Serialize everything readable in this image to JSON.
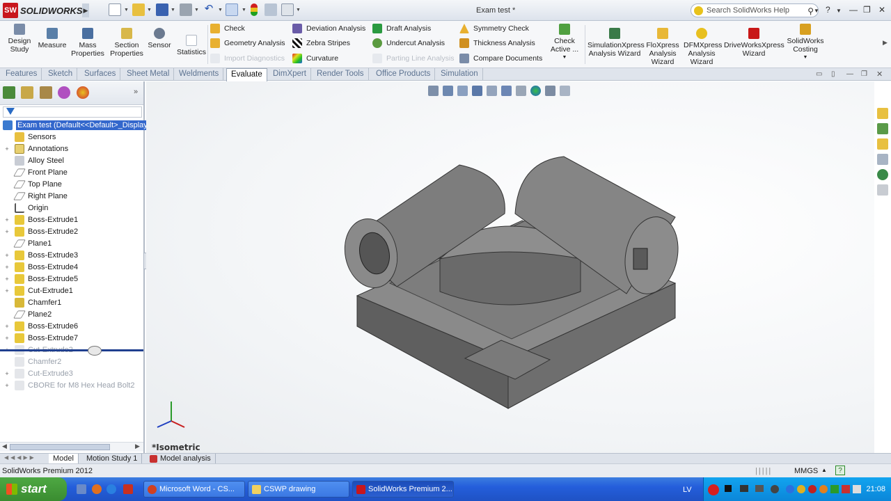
{
  "app": {
    "name": "SOLIDWORKS",
    "document_title": "Exam test *",
    "search_placeholder": "Search SolidWorks Help"
  },
  "toolbar": {
    "big_tools": [
      {
        "label": "Design\nStudy",
        "icon": "design-study-icon"
      },
      {
        "label": "Measure",
        "icon": "measure-icon"
      },
      {
        "label": "Mass\nProperties",
        "icon": "mass-properties-icon"
      },
      {
        "label": "Section\nProperties",
        "icon": "section-properties-icon"
      },
      {
        "label": "Sensor",
        "icon": "sensor-icon"
      },
      {
        "label": "Statistics",
        "icon": "statistics-icon"
      }
    ],
    "col1": [
      "Check",
      "Geometry Analysis",
      "Import Diagnostics"
    ],
    "col2": [
      "Deviation Analysis",
      "Zebra Stripes",
      "Curvature"
    ],
    "col3": [
      "Draft Analysis",
      "Undercut Analysis",
      "Parting Line Analysis"
    ],
    "col4": [
      "Symmetry Check",
      "Thickness Analysis",
      "Compare Documents"
    ],
    "check_active": "Check\nActive ...",
    "wizards": [
      "SimulationXpress\nAnalysis Wizard",
      "FloXpress\nAnalysis\nWizard",
      "DFMXpress\nAnalysis\nWizard",
      "DriveWorksXpress\nWizard",
      "SolidWorks\nCosting"
    ]
  },
  "tabs": [
    "Features",
    "Sketch",
    "Surfaces",
    "Sheet Metal",
    "Weldments",
    "Evaluate",
    "DimXpert",
    "Render Tools",
    "Office Products",
    "Simulation"
  ],
  "active_tab": "Evaluate",
  "tree": {
    "root": "Exam test  (Default<<Default>_Display",
    "items": [
      {
        "label": "Sensors",
        "icon": "sensor-folder-icon",
        "exp": "",
        "sup": false
      },
      {
        "label": "Annotations",
        "icon": "annotations-icon",
        "exp": "+",
        "sup": false
      },
      {
        "label": "Alloy Steel",
        "icon": "material-icon",
        "exp": "",
        "sup": false
      },
      {
        "label": "Front Plane",
        "icon": "plane-icon",
        "exp": "",
        "sup": false
      },
      {
        "label": "Top Plane",
        "icon": "plane-icon",
        "exp": "",
        "sup": false
      },
      {
        "label": "Right Plane",
        "icon": "plane-icon",
        "exp": "",
        "sup": false
      },
      {
        "label": "Origin",
        "icon": "origin-icon",
        "exp": "",
        "sup": false
      },
      {
        "label": "Boss-Extrude1",
        "icon": "extrude-icon",
        "exp": "+",
        "sup": false
      },
      {
        "label": "Boss-Extrude2",
        "icon": "extrude-icon",
        "exp": "+",
        "sup": false
      },
      {
        "label": "Plane1",
        "icon": "plane-icon",
        "exp": "",
        "sup": false
      },
      {
        "label": "Boss-Extrude3",
        "icon": "extrude-icon",
        "exp": "+",
        "sup": false
      },
      {
        "label": "Boss-Extrude4",
        "icon": "extrude-icon",
        "exp": "+",
        "sup": false
      },
      {
        "label": "Boss-Extrude5",
        "icon": "extrude-icon",
        "exp": "+",
        "sup": false
      },
      {
        "label": "Cut-Extrude1",
        "icon": "cut-extrude-icon",
        "exp": "+",
        "sup": false
      },
      {
        "label": "Chamfer1",
        "icon": "chamfer-icon",
        "exp": "",
        "sup": false
      },
      {
        "label": "Plane2",
        "icon": "plane-icon",
        "exp": "",
        "sup": false
      },
      {
        "label": "Boss-Extrude6",
        "icon": "extrude-icon",
        "exp": "+",
        "sup": false
      },
      {
        "label": "Boss-Extrude7",
        "icon": "extrude-icon",
        "exp": "+",
        "sup": false
      },
      {
        "label": "Cut-Extrude2",
        "icon": "cut-extrude-icon",
        "exp": "+",
        "sup": true
      },
      {
        "label": "Chamfer2",
        "icon": "chamfer-icon",
        "exp": "",
        "sup": true
      },
      {
        "label": "Cut-Extrude3",
        "icon": "cut-extrude-icon",
        "exp": "+",
        "sup": true
      },
      {
        "label": "CBORE for M8 Hex Head Bolt2",
        "icon": "hole-wizard-icon",
        "exp": "+",
        "sup": true
      }
    ]
  },
  "view": {
    "label": "*Isometric"
  },
  "model_tabs": [
    "Model",
    "Motion Study 1",
    "Model analysis"
  ],
  "status": {
    "left": "SolidWorks Premium 2012",
    "units": "MMGS"
  },
  "taskbar": {
    "start": "start",
    "tasks": [
      "Microsoft Word - CS...",
      "CSWP drawing",
      "SolidWorks Premium 2..."
    ],
    "lang": "LV",
    "clock": "21:08"
  },
  "colors": {
    "accent": "#3367cc",
    "selection": "#3367cc",
    "taskbar": "#245edb"
  }
}
